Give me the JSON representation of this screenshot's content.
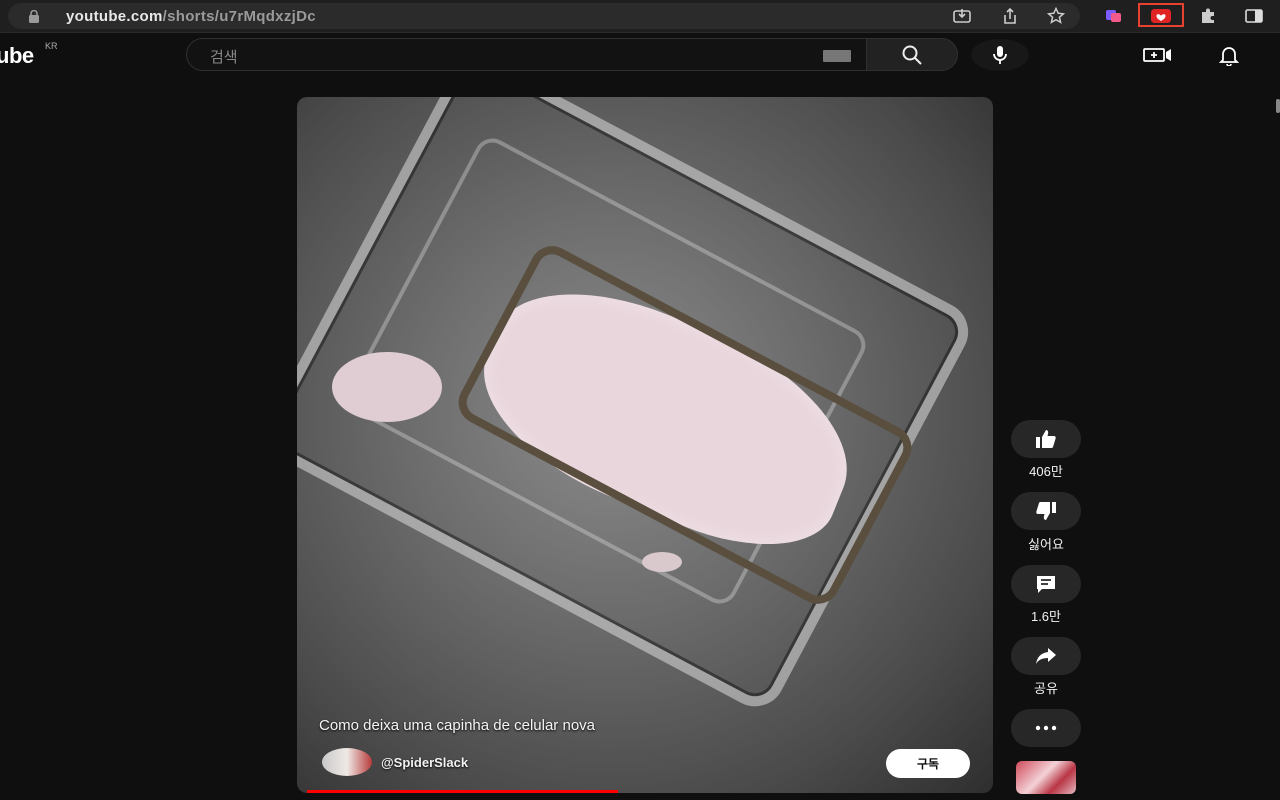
{
  "browser": {
    "url_host": "youtube.com",
    "url_path": "/shorts/u7rMqdxzjDc"
  },
  "header": {
    "logo_text": "ube",
    "region": "KR",
    "search_placeholder": "검색"
  },
  "video": {
    "caption": "Como deixa uma capinha de celular nova",
    "channel": "@SpiderSlack",
    "subscribe_label": "구독",
    "progress_fraction": 0.46
  },
  "actions": {
    "likes": "406만",
    "dislike_label": "싫어요",
    "comments": "1.6만",
    "share_label": "공유"
  },
  "colors": {
    "background": "#0f0f0f",
    "accent": "#ff0000",
    "highlight_box": "#e8412f"
  }
}
